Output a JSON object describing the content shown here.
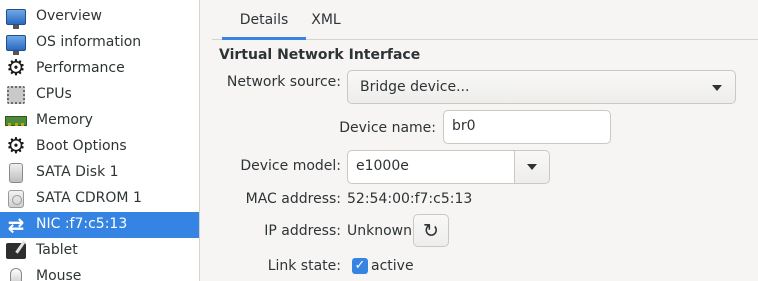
{
  "sidebar": {
    "items": [
      {
        "label": "Overview",
        "icon": "monitor-icon"
      },
      {
        "label": "OS information",
        "icon": "monitor-icon"
      },
      {
        "label": "Performance",
        "icon": "gear-icon"
      },
      {
        "label": "CPUs",
        "icon": "cpu-icon"
      },
      {
        "label": "Memory",
        "icon": "memory-icon"
      },
      {
        "label": "Boot Options",
        "icon": "gear-icon"
      },
      {
        "label": "SATA Disk 1",
        "icon": "disk-icon"
      },
      {
        "label": "SATA CDROM 1",
        "icon": "cdrom-icon"
      },
      {
        "label": "NIC :f7:c5:13",
        "icon": "nic-icon",
        "selected": true
      },
      {
        "label": "Tablet",
        "icon": "tablet-icon"
      },
      {
        "label": "Mouse",
        "icon": "mouse-icon"
      }
    ],
    "selected_color": "#3584e4"
  },
  "tabs": [
    {
      "label": "Details",
      "active": true
    },
    {
      "label": "XML",
      "active": false
    }
  ],
  "section": {
    "title": "Virtual Network Interface"
  },
  "form": {
    "network_source": {
      "label": "Network source:",
      "value": "Bridge device..."
    },
    "device_name": {
      "label": "Device name:",
      "value": "br0"
    },
    "device_model": {
      "label": "Device model:",
      "value": "e1000e"
    },
    "mac_address": {
      "label": "MAC address:",
      "value": "52:54:00:f7:c5:13"
    },
    "ip_address": {
      "label": "IP address:",
      "value": "Unknown"
    },
    "link_state": {
      "label": "Link state:",
      "value": "active",
      "checked": true
    }
  },
  "colors": {
    "accent": "#3584e4",
    "background": "#f6f5f4"
  }
}
